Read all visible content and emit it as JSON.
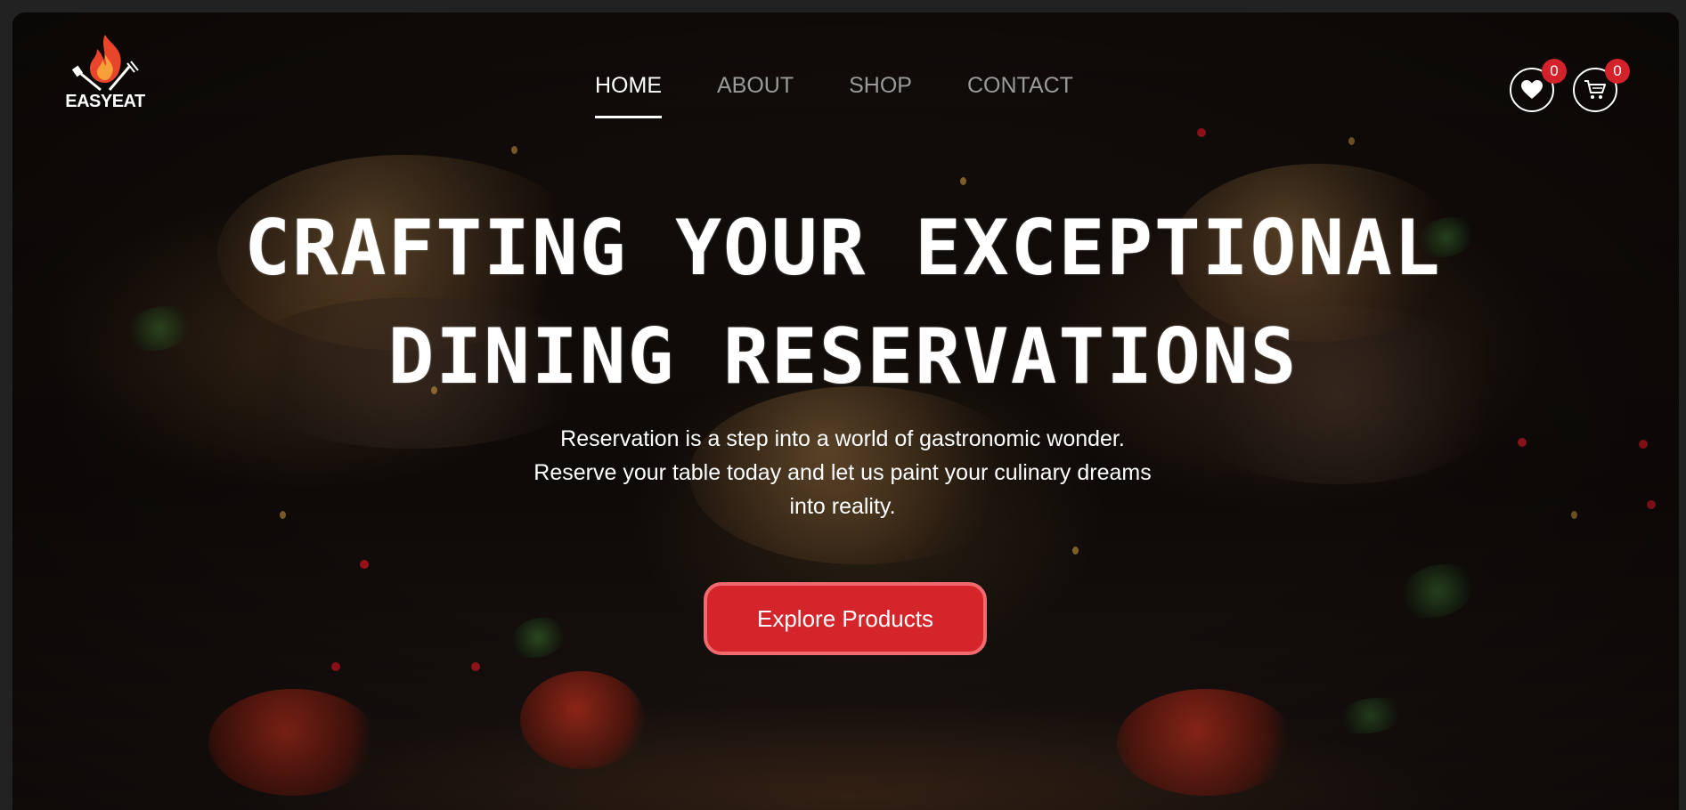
{
  "brand": {
    "logo_text": "EASYEAT",
    "logo_icon": "flame-grill-icon",
    "accent_color": "#d4252b"
  },
  "nav": {
    "items": [
      {
        "label": "HOME",
        "active": true
      },
      {
        "label": "ABOUT",
        "active": false
      },
      {
        "label": "SHOP",
        "active": false
      },
      {
        "label": "CONTACT",
        "active": false
      }
    ]
  },
  "header_actions": {
    "wishlist": {
      "icon": "heart-icon",
      "count": "0"
    },
    "cart": {
      "icon": "cart-icon",
      "count": "0"
    }
  },
  "hero": {
    "headline_line1": "CRAFTING YOUR EXCEPTIONAL",
    "headline_line2": "DINING RESERVATIONS",
    "subtext": "Reservation is a step into a world of gastronomic wonder. Reserve your table today and let us paint your culinary dreams into reality.",
    "cta_label": "Explore Products"
  }
}
